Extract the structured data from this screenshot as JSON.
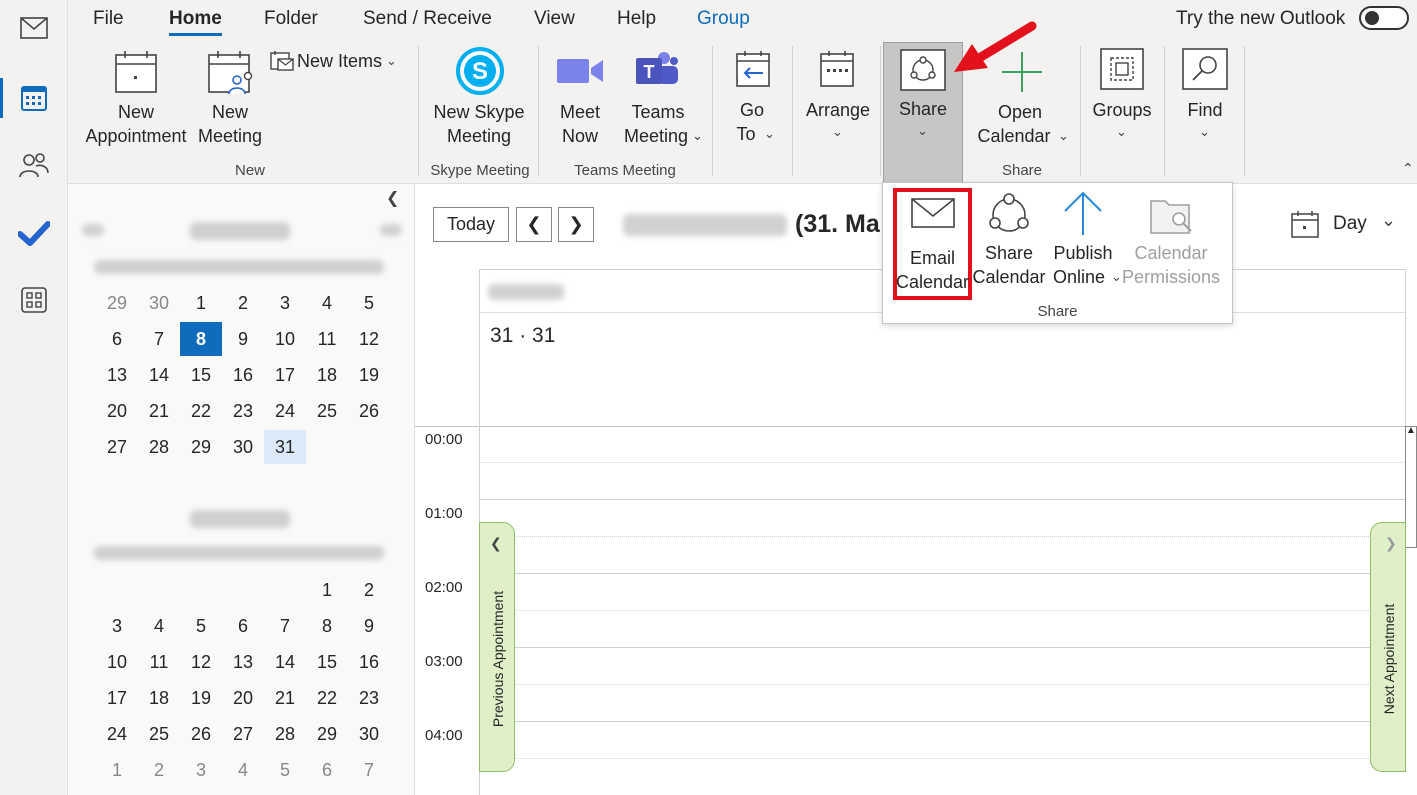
{
  "tabs": [
    "File",
    "Home",
    "Folder",
    "Send / Receive",
    "View",
    "Help",
    "Group"
  ],
  "try_new": "Try the new Outlook",
  "ribbon": {
    "new_appointment": [
      "New",
      "Appointment"
    ],
    "new_meeting": [
      "New",
      "Meeting"
    ],
    "new_items": "New Items",
    "group_new": "New",
    "new_skype": [
      "New Skype",
      "Meeting"
    ],
    "group_skype": "Skype Meeting",
    "meet_now": [
      "Meet",
      "Now"
    ],
    "teams_meeting": [
      "Teams",
      "Meeting"
    ],
    "group_teams": "Teams Meeting",
    "go_to": [
      "Go",
      "To"
    ],
    "arrange": "Arrange",
    "share": "Share",
    "open_calendar": [
      "Open",
      "Calendar"
    ],
    "group_share": "Share",
    "groups": "Groups",
    "find": "Find"
  },
  "share_menu": {
    "email_calendar": [
      "Email",
      "Calendar"
    ],
    "share_calendar": [
      "Share",
      "Calendar"
    ],
    "publish_online": [
      "Publish",
      "Online"
    ],
    "calendar_permissions": [
      "Calendar",
      "Permissions"
    ],
    "group_label": "Share"
  },
  "toolbar": {
    "today": "Today",
    "date_heading": "(31. Ma",
    "view": "Day"
  },
  "day_header": "31 · 31",
  "hours": [
    "00:00",
    "01:00",
    "02:00",
    "03:00",
    "04:00"
  ],
  "previous_appointment": "Previous Appointment",
  "next_appointment": "Next Appointment",
  "month1": {
    "weeks": [
      [
        "29",
        "30",
        "1",
        "2",
        "3",
        "4",
        "5"
      ],
      [
        "6",
        "7",
        "8",
        "9",
        "10",
        "11",
        "12"
      ],
      [
        "13",
        "14",
        "15",
        "16",
        "17",
        "18",
        "19"
      ],
      [
        "20",
        "21",
        "22",
        "23",
        "24",
        "25",
        "26"
      ],
      [
        "27",
        "28",
        "29",
        "30",
        "31",
        "",
        ""
      ]
    ]
  },
  "month2": {
    "weeks": [
      [
        "",
        "",
        "",
        "",
        "",
        "1",
        "2"
      ],
      [
        "3",
        "4",
        "5",
        "6",
        "7",
        "8",
        "9"
      ],
      [
        "10",
        "11",
        "12",
        "13",
        "14",
        "15",
        "16"
      ],
      [
        "17",
        "18",
        "19",
        "20",
        "21",
        "22",
        "23"
      ],
      [
        "24",
        "25",
        "26",
        "27",
        "28",
        "29",
        "30"
      ],
      [
        "1",
        "2",
        "3",
        "4",
        "5",
        "6",
        "7"
      ]
    ]
  },
  "colors": {
    "accent": "#0f6cbd",
    "highlight_box": "#e3111b",
    "arrow": "#e3111b",
    "appointment_tab": "#dff0c8"
  }
}
